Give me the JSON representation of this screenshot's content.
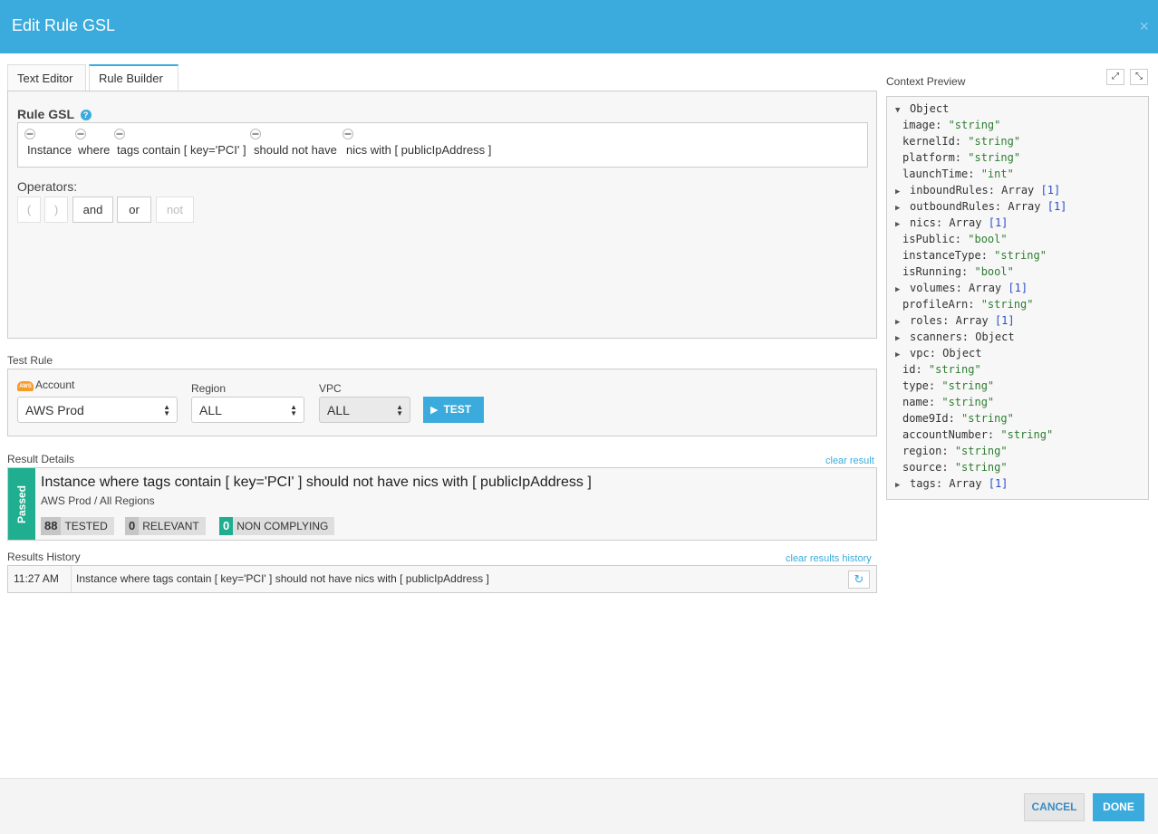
{
  "dialog": {
    "title": "Edit Rule GSL",
    "close_glyph": "×"
  },
  "tabs": [
    {
      "label": "Text Editor",
      "active": false
    },
    {
      "label": "Rule Builder",
      "active": true
    }
  ],
  "rule_builder": {
    "label": "Rule GSL",
    "help_glyph": "?",
    "tokens": [
      "Instance",
      "where",
      "tags contain [ key='PCI' ]",
      "should not have",
      "nics with [ publicIpAddress ]"
    ],
    "operators_label": "Operators:",
    "operators": [
      {
        "label": "(",
        "enabled": false
      },
      {
        "label": ")",
        "enabled": false
      },
      {
        "label": "and",
        "enabled": true
      },
      {
        "label": "or",
        "enabled": true
      },
      {
        "label": "not",
        "enabled": false
      }
    ]
  },
  "test_rule": {
    "section_label": "Test Rule",
    "aws_badge": "AWS",
    "account_label": "Account",
    "account_value": "AWS Prod",
    "region_label": "Region",
    "region_value": "ALL",
    "vpc_label": "VPC",
    "vpc_value": "ALL",
    "test_button": "TEST"
  },
  "result_details": {
    "section_label": "Result Details",
    "clear_link": "clear result",
    "status": "Passed",
    "title": "Instance where tags contain [ key='PCI' ] should not have nics with [ publicIpAddress ]",
    "subtitle": "AWS Prod / All Regions",
    "stats": [
      {
        "value": "88",
        "label": "TESTED"
      },
      {
        "value": "0",
        "label": "RELEVANT"
      },
      {
        "value": "0",
        "label": "NON COMPLYING"
      }
    ],
    "status_color": "#1fae8f"
  },
  "results_history": {
    "section_label": "Results History",
    "clear_link": "clear results history",
    "rows": [
      {
        "time": "11:27 AM",
        "rule": "Instance where tags contain [ key='PCI' ] should not have nics with [ publicIpAddress ]"
      }
    ]
  },
  "context_preview": {
    "label": "Context Preview",
    "root": "Object",
    "fields": [
      {
        "key": "image",
        "value": "\"string\"",
        "kind": "str",
        "expandable": false
      },
      {
        "key": "kernelId",
        "value": "\"string\"",
        "kind": "str",
        "expandable": false
      },
      {
        "key": "platform",
        "value": "\"string\"",
        "kind": "str",
        "expandable": false
      },
      {
        "key": "launchTime",
        "value": "\"int\"",
        "kind": "str",
        "expandable": false
      },
      {
        "key": "inboundRules",
        "value": "Array",
        "count": "[1]",
        "kind": "arr",
        "expandable": true
      },
      {
        "key": "outboundRules",
        "value": "Array",
        "count": "[1]",
        "kind": "arr",
        "expandable": true
      },
      {
        "key": "nics",
        "value": "Array",
        "count": "[1]",
        "kind": "arr",
        "expandable": true
      },
      {
        "key": "isPublic",
        "value": "\"bool\"",
        "kind": "str",
        "expandable": false
      },
      {
        "key": "instanceType",
        "value": "\"string\"",
        "kind": "str",
        "expandable": false
      },
      {
        "key": "isRunning",
        "value": "\"bool\"",
        "kind": "str",
        "expandable": false
      },
      {
        "key": "volumes",
        "value": "Array",
        "count": "[1]",
        "kind": "arr",
        "expandable": true
      },
      {
        "key": "profileArn",
        "value": "\"string\"",
        "kind": "str",
        "expandable": false
      },
      {
        "key": "roles",
        "value": "Array",
        "count": "[1]",
        "kind": "arr",
        "expandable": true
      },
      {
        "key": "scanners",
        "value": "Object",
        "kind": "obj",
        "expandable": true
      },
      {
        "key": "vpc",
        "value": "Object",
        "kind": "obj",
        "expandable": true
      },
      {
        "key": "id",
        "value": "\"string\"",
        "kind": "str",
        "expandable": false
      },
      {
        "key": "type",
        "value": "\"string\"",
        "kind": "str",
        "expandable": false
      },
      {
        "key": "name",
        "value": "\"string\"",
        "kind": "str",
        "expandable": false
      },
      {
        "key": "dome9Id",
        "value": "\"string\"",
        "kind": "str",
        "expandable": false
      },
      {
        "key": "accountNumber",
        "value": "\"string\"",
        "kind": "str",
        "expandable": false
      },
      {
        "key": "region",
        "value": "\"string\"",
        "kind": "str",
        "expandable": false
      },
      {
        "key": "source",
        "value": "\"string\"",
        "kind": "str",
        "expandable": false
      },
      {
        "key": "tags",
        "value": "Array",
        "count": "[1]",
        "kind": "arr",
        "expandable": true
      }
    ]
  },
  "footer": {
    "cancel": "CANCEL",
    "done": "DONE"
  },
  "icons": {
    "close": "close-icon",
    "help": "help-icon",
    "trash": "trash-icon",
    "aws": "aws-icon",
    "play": "play-icon",
    "refresh": "refresh-icon",
    "expand": "expand-icon",
    "collapse": "collapse-icon"
  },
  "colors": {
    "accent": "#3aabdc",
    "passed": "#1fae8f"
  }
}
